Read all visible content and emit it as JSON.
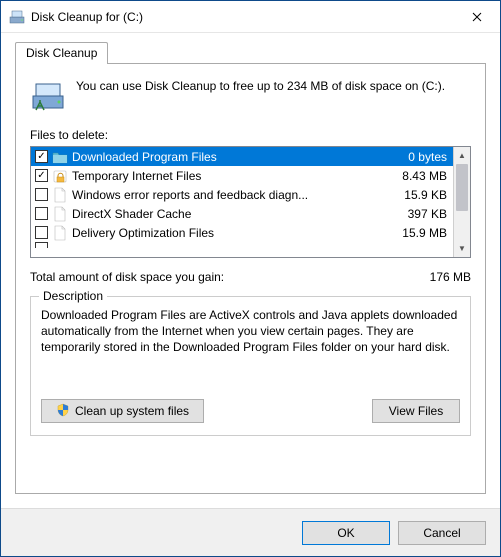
{
  "titlebar": {
    "title": "Disk Cleanup for  (C:)"
  },
  "tabs": {
    "main": "Disk Cleanup"
  },
  "intro": "You can use Disk Cleanup to free up to 234 MB of disk space on (C:).",
  "files_label": "Files to delete:",
  "files": [
    {
      "checked": true,
      "icon": "folder",
      "name": "Downloaded Program Files",
      "size": "0 bytes",
      "selected": true
    },
    {
      "checked": true,
      "icon": "lock",
      "name": "Temporary Internet Files",
      "size": "8.43 MB",
      "selected": false
    },
    {
      "checked": false,
      "icon": "file",
      "name": "Windows error reports and feedback diagn...",
      "size": "15.9 KB",
      "selected": false
    },
    {
      "checked": false,
      "icon": "file",
      "name": "DirectX Shader Cache",
      "size": "397 KB",
      "selected": false
    },
    {
      "checked": false,
      "icon": "file",
      "name": "Delivery Optimization Files",
      "size": "15.9 MB",
      "selected": false
    }
  ],
  "total": {
    "label": "Total amount of disk space you gain:",
    "value": "176 MB"
  },
  "description": {
    "group_label": "Description",
    "text": "Downloaded Program Files are ActiveX controls and Java applets downloaded automatically from the Internet when you view certain pages. They are temporarily stored in the Downloaded Program Files folder on your hard disk.",
    "clean_system": "Clean up system files",
    "view_files": "View Files"
  },
  "footer": {
    "ok": "OK",
    "cancel": "Cancel"
  }
}
